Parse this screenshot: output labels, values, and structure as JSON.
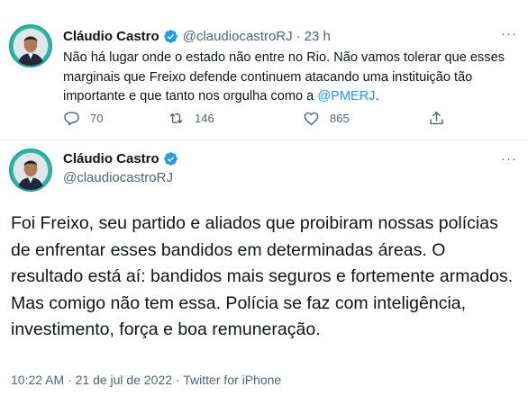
{
  "tweet1": {
    "author_name": "Cláudio Castro",
    "handle": "@claudiocastroRJ",
    "separator": "·",
    "time": "23 h",
    "more": "···",
    "text_before_mention": "Não há lugar onde o estado não entre no Rio. Não vamos tolerar que esses marginais que Freixo defende continuem atacando uma instituição tão importante e que tanto nos orgulha como a ",
    "mention": "@PMERJ",
    "text_after_mention": ".",
    "replies": "70",
    "retweets": "146",
    "likes": "865"
  },
  "tweet2": {
    "author_name": "Cláudio Castro",
    "handle": "@claudiocastroRJ",
    "more": "···",
    "text": "Foi Freixo, seu partido e aliados que proibiram nossas polícias de enfrentar esses bandidos em determinadas áreas. O resultado está aí: bandidos mais seguros e fortemente armados. Mas comigo não tem essa. Polícia se faz com inteligência, investimento, força e boa remuneração.",
    "time": "10:22 AM",
    "separator": "·",
    "date": "21 de jul de 2022",
    "source": "Twitter for iPhone"
  },
  "icons": [
    "verified-badge-icon",
    "reply-icon",
    "retweet-icon",
    "like-icon",
    "share-icon",
    "more-icon"
  ],
  "colors": {
    "text": "#0f1419",
    "secondary": "#536471",
    "accent": "#1d9bf0",
    "divider": "#eff3f4",
    "avatar_ring": "#2fb8a8"
  }
}
